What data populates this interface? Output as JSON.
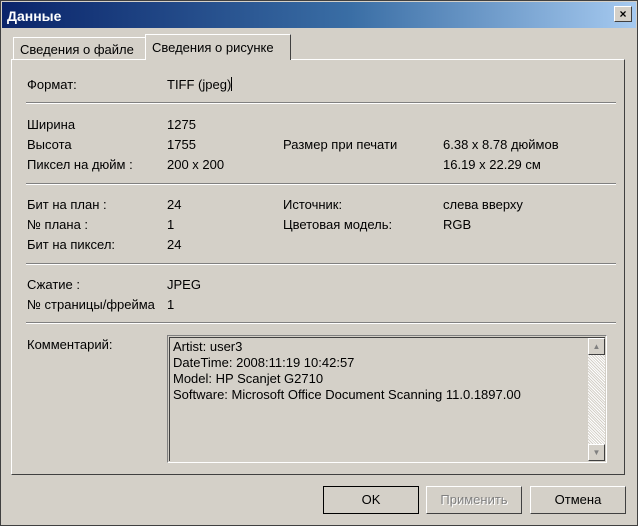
{
  "window": {
    "title": "Данные",
    "close_label": "×"
  },
  "tabs": [
    {
      "label": "Сведения о файле",
      "active": false
    },
    {
      "label": "Сведения о рисунке",
      "active": true
    }
  ],
  "format": {
    "label": "Формат:",
    "value": "TIFF (jpeg)"
  },
  "dimensions": {
    "width_label": "Ширина",
    "width_value": "1275",
    "height_label": "Высота",
    "height_value": "1755",
    "dpi_label": "Пиксел на дюйм :",
    "dpi_value": "200 x 200",
    "print_size_label": "Размер при печати",
    "print_size_inches": "6.38 x 8.78 дюймов",
    "print_size_cm": "16.19 x 22.29 см"
  },
  "bits": {
    "bits_per_plane_label": "Бит на план :",
    "bits_per_plane_value": "24",
    "plane_no_label": "№ плана :",
    "plane_no_value": "1",
    "bits_per_pixel_label": "Бит на пиксел:",
    "bits_per_pixel_value": "24",
    "source_label": "Источник:",
    "source_value": "слева вверху",
    "color_model_label": "Цветовая модель:",
    "color_model_value": "RGB"
  },
  "compression": {
    "compression_label": "Сжатие :",
    "compression_value": "JPEG",
    "page_frame_label": "№ страницы/фрейма",
    "page_frame_value": "1"
  },
  "comment": {
    "label": "Комментарий:",
    "lines": [
      "Artist: user3",
      "DateTime: 2008:11:19 10:42:57",
      "Model: HP Scanjet G2710",
      "Software: Microsoft Office Document Scanning  11.0.1897.00"
    ]
  },
  "buttons": {
    "ok": "OK",
    "apply": "Применить",
    "cancel": "Отмена"
  }
}
